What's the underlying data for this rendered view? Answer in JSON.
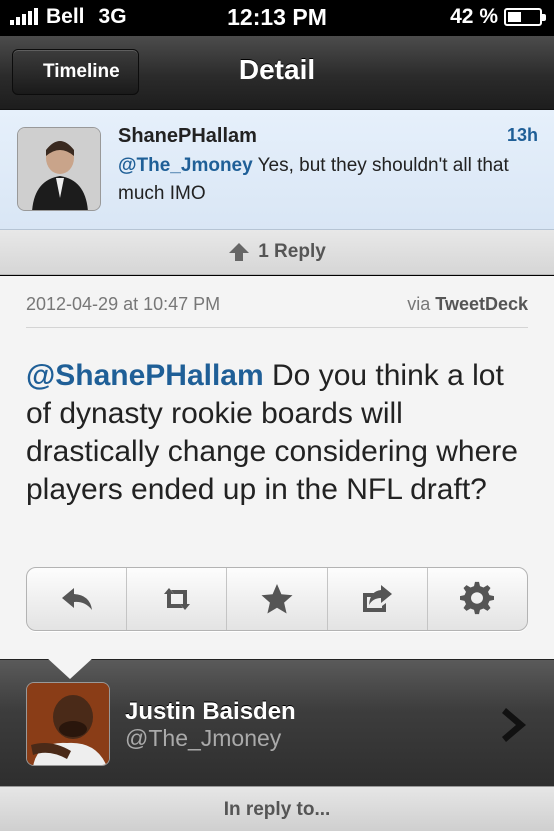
{
  "status_bar": {
    "carrier": "Bell",
    "network": "3G",
    "time": "12:13 PM",
    "battery_percent_label": "42 %",
    "battery_level": 0.42,
    "signal_bars": 5
  },
  "nav": {
    "back_label": "Timeline",
    "title": "Detail"
  },
  "parent_tweet": {
    "author": "ShanePHallam",
    "age": "13h",
    "mention": "@The_Jmoney",
    "text": " Yes, but they shouldn't all that much IMO"
  },
  "replies": {
    "label": "1 Reply"
  },
  "tweet": {
    "date": "2012-04-29 at 10:47 PM",
    "via_prefix": "via ",
    "via_client": "TweetDeck",
    "mention": "@ShanePHallam",
    "text": " Do you think a lot of dynasty rookie boards will drastically change considering where players ended up in the NFL draft?"
  },
  "actions": [
    {
      "name": "reply-icon"
    },
    {
      "name": "retweet-icon"
    },
    {
      "name": "star-icon"
    },
    {
      "name": "share-icon"
    },
    {
      "name": "gear-icon"
    }
  ],
  "author": {
    "name": "Justin Baisden",
    "handle": "@The_Jmoney"
  },
  "footer": {
    "in_reply_label": "In reply to..."
  },
  "colors": {
    "link_blue": "#1f5f97",
    "nav_dark": "#2b2b2b",
    "parent_bg": "#e6f0fb"
  }
}
